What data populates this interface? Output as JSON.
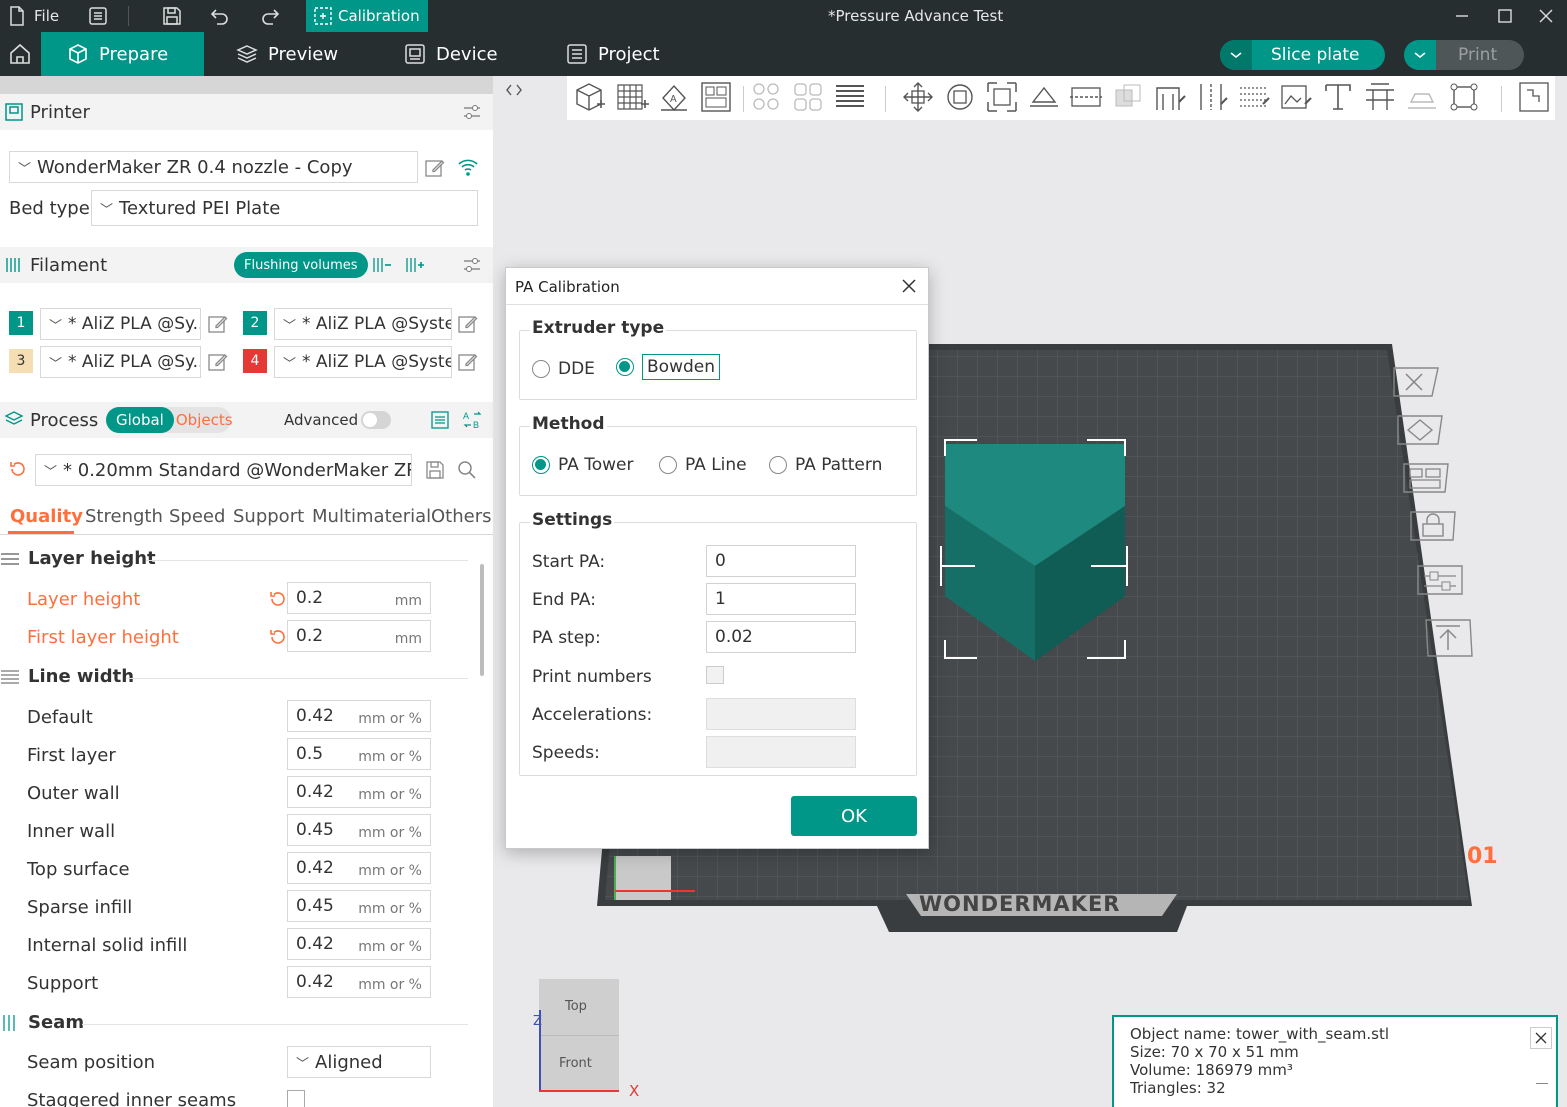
{
  "titlebar": {
    "file_label": "File",
    "calibration_label": "Calibration",
    "window_title": "*Pressure Advance Test"
  },
  "nav": {
    "tabs": [
      {
        "label": "Prepare",
        "active": true
      },
      {
        "label": "Preview"
      },
      {
        "label": "Device"
      },
      {
        "label": "Project"
      }
    ],
    "slice_plate_label": "Slice plate",
    "print_label": "Print"
  },
  "printer": {
    "section_label": "Printer",
    "printer_value": "WonderMaker ZR 0.4 nozzle - Copy",
    "bed_type_label": "Bed type",
    "bed_type_value": "Textured PEI Plate"
  },
  "filament": {
    "section_label": "Filament",
    "flushing_label": "Flushing volumes",
    "slots": [
      {
        "num": "1",
        "name": "* AliZ PLA @Sy...",
        "color": "#009688",
        "textcolor": "#ffffff"
      },
      {
        "num": "2",
        "name": "* AliZ PLA @Syste...",
        "color": "#009688",
        "textcolor": "#ffffff"
      },
      {
        "num": "3",
        "name": "* AliZ PLA @Sy...",
        "color": "#f5deb3",
        "textcolor": "#333333"
      },
      {
        "num": "4",
        "name": "* AliZ PLA @Syste...",
        "color": "#e53935",
        "textcolor": "#ffffff"
      }
    ]
  },
  "process": {
    "section_label": "Process",
    "global_label": "Global",
    "objects_label": "Objects",
    "advanced_label": "Advanced",
    "profile_value": "* 0.20mm Standard @WonderMaker ZR",
    "tabs": [
      "Quality",
      "Strength",
      "Speed",
      "Support",
      "Multimaterial",
      "Others"
    ]
  },
  "quality": {
    "layer_height_group": "Layer height",
    "layer_height_label": "Layer height",
    "layer_height_value": "0.2",
    "first_layer_height_label": "First layer height",
    "first_layer_height_value": "0.2",
    "mm_unit": "mm",
    "line_width_group": "Line width",
    "mm_or_pct_unit": "mm or %",
    "line_widths": [
      {
        "label": "Default",
        "value": "0.42"
      },
      {
        "label": "First layer",
        "value": "0.5"
      },
      {
        "label": "Outer wall",
        "value": "0.42"
      },
      {
        "label": "Inner wall",
        "value": "0.45"
      },
      {
        "label": "Top surface",
        "value": "0.42"
      },
      {
        "label": "Sparse infill",
        "value": "0.45"
      },
      {
        "label": "Internal solid infill",
        "value": "0.42"
      },
      {
        "label": "Support",
        "value": "0.42"
      }
    ],
    "seam_group": "Seam",
    "seam_position_label": "Seam position",
    "seam_position_value": "Aligned",
    "staggered_label": "Staggered inner seams"
  },
  "dialog": {
    "title": "PA Calibration",
    "extruder_group": "Extruder type",
    "extruder_options": [
      "DDE",
      "Bowden"
    ],
    "extruder_selected": "Bowden",
    "method_group": "Method",
    "method_options": [
      "PA Tower",
      "PA Line",
      "PA Pattern"
    ],
    "method_selected": "PA Tower",
    "settings_group": "Settings",
    "start_pa_label": "Start PA:",
    "start_pa_value": "0",
    "end_pa_label": "End PA:",
    "end_pa_value": "1",
    "pa_step_label": "PA step:",
    "pa_step_value": "0.02",
    "print_numbers_label": "Print numbers",
    "accelerations_label": "Accelerations:",
    "speeds_label": "Speeds:",
    "ok_label": "OK"
  },
  "viewport": {
    "plate_brand": "WONDERMAKER",
    "plate_number": "01",
    "view_cube_top": "Top",
    "view_cube_front": "Front",
    "axis_x": "X",
    "axis_z": "Z"
  },
  "object_info": {
    "name_line": "Object name: tower_with_seam.stl",
    "size_line": "Size: 70 x 70 x 51 mm",
    "volume_line": "Volume: 186979 mm³",
    "triangles_line": "Triangles: 32"
  },
  "colors": {
    "accent": "#009688",
    "dark_bar": "#262e30",
    "modified": "#ff6f3c"
  }
}
